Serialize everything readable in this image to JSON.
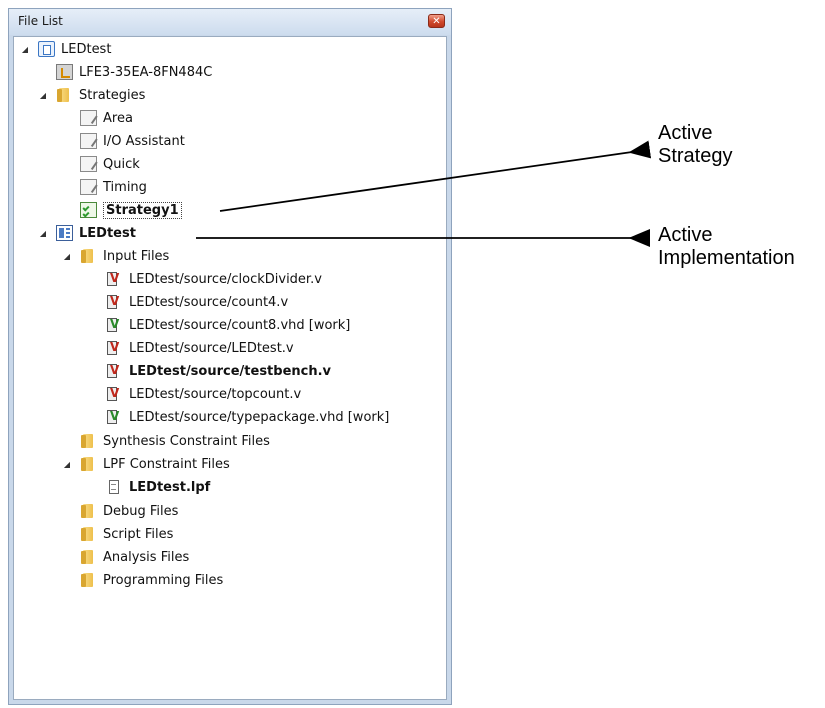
{
  "panel": {
    "title": "File List",
    "close_icon": "close-icon"
  },
  "tree": {
    "project": "LEDtest",
    "device": "LFE3-35EA-8FN484C",
    "strategies_folder": "Strategies",
    "strategies": [
      "Area",
      "I/O Assistant",
      "Quick",
      "Timing"
    ],
    "active_strategy": "Strategy1",
    "implementation": "LEDtest",
    "input_files_folder": "Input Files",
    "input_files": [
      "LEDtest/source/clockDivider.v",
      "LEDtest/source/count4.v",
      "LEDtest/source/count8.vhd [work]",
      "LEDtest/source/LEDtest.v",
      "LEDtest/source/testbench.v",
      "LEDtest/source/topcount.v",
      "LEDtest/source/typepackage.vhd [work]"
    ],
    "synthesis_folder": "Synthesis Constraint Files",
    "lpf_folder": "LPF Constraint Files",
    "lpf_file": "LEDtest.lpf",
    "debug_folder": "Debug Files",
    "script_folder": "Script Files",
    "analysis_folder": "Analysis Files",
    "programming_folder": "Programming Files"
  },
  "annotations": {
    "active_strategy_line1": "Active",
    "active_strategy_line2": "Strategy",
    "active_impl_line1": "Active",
    "active_impl_line2": "Implementation"
  }
}
